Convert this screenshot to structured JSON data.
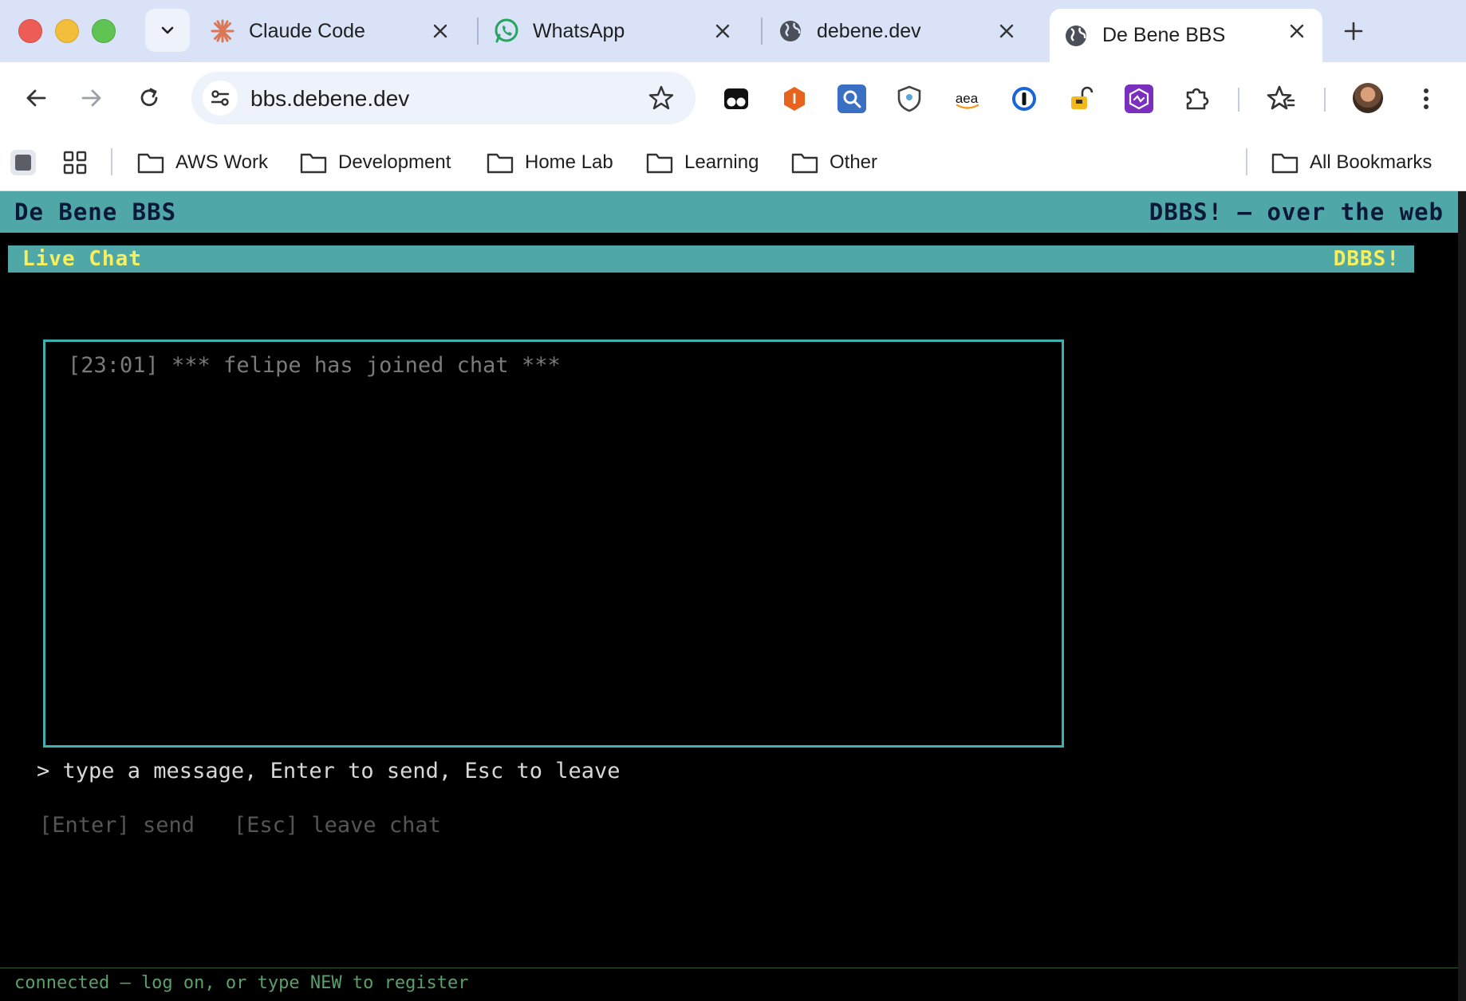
{
  "browser": {
    "tabs": [
      {
        "title": "Claude Code",
        "icon": "claude-icon",
        "active": false
      },
      {
        "title": "WhatsApp",
        "icon": "whatsapp-icon",
        "active": false
      },
      {
        "title": "debene.dev",
        "icon": "globe-icon",
        "active": false
      },
      {
        "title": "De Bene BBS",
        "icon": "globe-icon",
        "active": true
      }
    ],
    "url": "bbs.debene.dev",
    "extensions": [
      "tampermonkey-icon",
      "honey-icon",
      "magnifier-icon",
      "shield-icon",
      "amazon-icon",
      "onepassword-icon",
      "lock-icon",
      "hexagon-icon",
      "puzzle-icon"
    ],
    "amazon_label": "aea",
    "honey_label": "I",
    "bookmarks": [
      "AWS Work",
      "Development",
      "Home Lab",
      "Learning",
      "Other"
    ],
    "all_bookmarks": "All Bookmarks"
  },
  "bbs": {
    "site_title": "De Bene BBS",
    "site_tagline": "DBBS! — over the web",
    "section_title": "Live Chat",
    "section_badge": "DBBS!",
    "messages": [
      "[23:01] *** felipe has joined chat ***"
    ],
    "prompt": "> type a message, Enter to send, Esc to leave",
    "key_hints": "[Enter] send   [Esc] leave chat",
    "status": "connected — log on, or type NEW to register"
  },
  "colors": {
    "teal": "#50a7a8",
    "yellow": "#f7ef5d",
    "navy": "#0b1838",
    "chat_border": "#3fb0b0",
    "status_green": "#5aa06a"
  }
}
